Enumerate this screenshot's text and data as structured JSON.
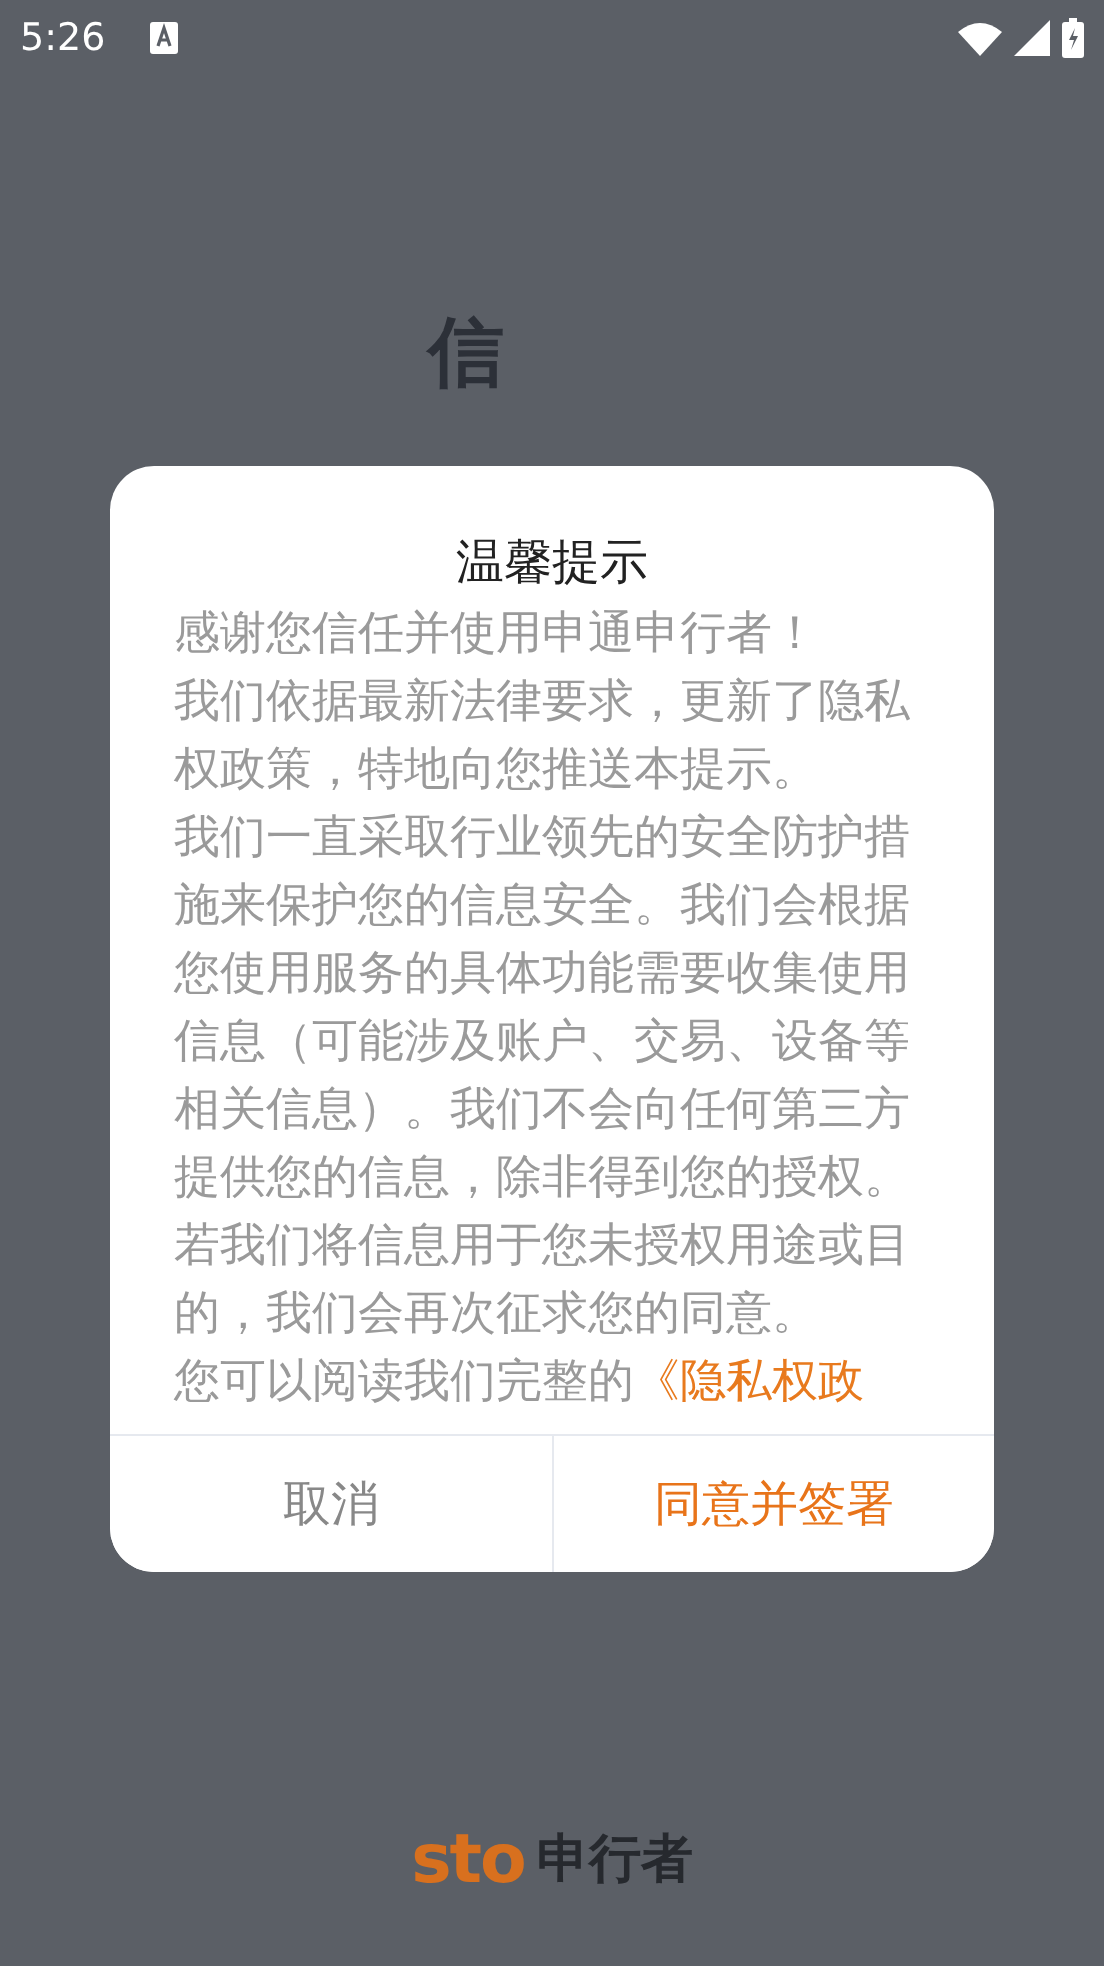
{
  "status_bar": {
    "time": "5:26"
  },
  "background": {
    "heading": [
      "信"
    ],
    "logo": {
      "brand": "sto",
      "name": "申行者"
    }
  },
  "dialog": {
    "title": "温馨提示",
    "paragraphs": [
      {
        "text": "感谢您信任并使用申通申行者！"
      },
      {
        "text": "我们依据最新法律要求，更新了隐私权政策，特地向您推送本提示。"
      },
      {
        "text": "我们一直采取行业领先的安全防护措施来保护您的信息安全。我们会根据您使用服务的具体功能需要收集使用信息（可能涉及账户、交易、设备等相关信息）。我们不会向任何第三方提供您的信息，除非得到您的授权。若我们将信息用于您未授权用途或目的，我们会再次征求您的同意。"
      },
      {
        "text": "您可以阅读我们完整的",
        "link": "《隐私权政"
      }
    ],
    "buttons": [
      {
        "label": "取消",
        "kind": "cancel"
      },
      {
        "label": "同意并签署",
        "kind": "confirm"
      }
    ]
  }
}
